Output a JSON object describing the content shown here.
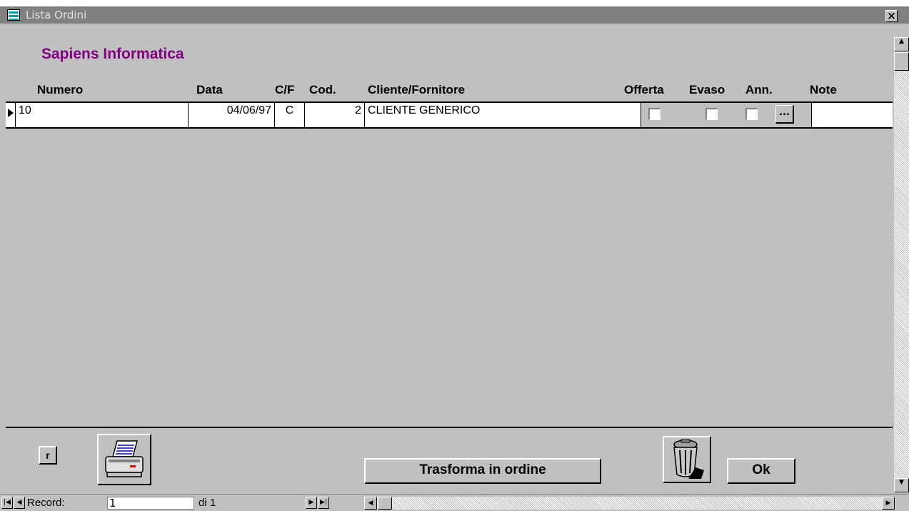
{
  "window": {
    "title": "Lista Ordini",
    "close_label": "×"
  },
  "company": "Sapiens Informatica",
  "columns": {
    "numero": "Numero",
    "data": "Data",
    "cf": "C/F",
    "cod": "Cod.",
    "cliente": "Cliente/Fornitore",
    "offerta": "Offerta",
    "evaso": "Evaso",
    "ann": "Ann.",
    "note": "Note"
  },
  "rows": [
    {
      "numero": "10",
      "data": "04/06/97",
      "cf": "C",
      "cod": "2",
      "cliente": "CLIENTE GENERICO",
      "offerta": false,
      "evaso": false,
      "ann": false,
      "note_button": "..."
    }
  ],
  "buttons": {
    "r": "r",
    "transform": "Trasforma in ordine",
    "ok": "Ok"
  },
  "status": {
    "record_label": "Record:",
    "record_value": "1",
    "of_label": "di 1"
  }
}
